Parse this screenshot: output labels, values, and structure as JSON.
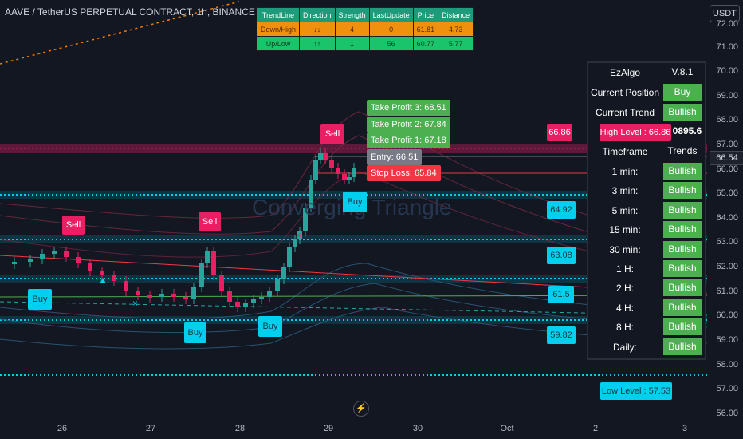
{
  "header": {
    "title": "AAVE / TetherUS PERPETUAL CONTRACT, 1h, BINANCE",
    "watermark": "Converging Triangle"
  },
  "currency_button": "USDT",
  "current_price": "66.54",
  "price_axis": [
    "72.00",
    "71.00",
    "70.00",
    "69.00",
    "68.00",
    "67.00",
    "66.00",
    "65.00",
    "64.00",
    "63.00",
    "62.00",
    "61.00",
    "60.00",
    "59.00",
    "58.00",
    "57.00",
    "56.00"
  ],
  "time_axis": [
    "26",
    "27",
    "28",
    "29",
    "30",
    "Oct",
    "2",
    "3"
  ],
  "trendline_table": {
    "headers": [
      "TrendLine",
      "Direction",
      "Strength",
      "LastUpdate",
      "Price",
      "Distance"
    ],
    "rows": [
      {
        "name": "Down/High",
        "direction": "↓↓",
        "strength": "4",
        "last_update": "0",
        "price": "61.81",
        "distance": "4.73"
      },
      {
        "name": "Up/Low",
        "direction": "↑↑",
        "strength": "1",
        "last_update": "56",
        "price": "60.77",
        "distance": "5.77"
      }
    ]
  },
  "trade_levels": {
    "tp3": "Take Profit 3: 68.51",
    "tp2": "Take Profit 2: 67.84",
    "tp1": "Take Profit 1: 67.18",
    "entry": "Entry: 66.51",
    "stop_loss": "Stop Loss: 65.84"
  },
  "signals": {
    "sell_1": "Sell",
    "sell_2": "Sell",
    "sell_3": "Sell",
    "buy_1": "Buy",
    "buy_2": "Buy",
    "buy_3": "Buy",
    "buy_4": "Buy"
  },
  "level_tags": {
    "l1": "66.86",
    "l2": "64.92",
    "l3": "63.08",
    "l4": "61.5",
    "l5": "59.82",
    "high_level": "High Level : 66.86",
    "low_level": "Low  Level : 57.53"
  },
  "ezalgo": {
    "title": "EzAlgo",
    "version": "V.8.1",
    "current_position_label": "Current Position",
    "current_position_value": "Buy",
    "current_trend_label": "Current Trend",
    "current_trend_value": "Bullish",
    "hidden_value": "0895.6",
    "timeframe_header": "Timeframe",
    "trends_header": "Trends",
    "rows": [
      {
        "tf": "1 min:",
        "trend": "Bullish"
      },
      {
        "tf": "3 min:",
        "trend": "Bullish"
      },
      {
        "tf": "5 min:",
        "trend": "Bullish"
      },
      {
        "tf": "15 min:",
        "trend": "Bullish"
      },
      {
        "tf": "30 min:",
        "trend": "Bullish"
      },
      {
        "tf": "1 H:",
        "trend": "Bullish"
      },
      {
        "tf": "2 H:",
        "trend": "Bullish"
      },
      {
        "tf": "4 H:",
        "trend": "Bullish"
      },
      {
        "tf": "8 H:",
        "trend": "Bullish"
      },
      {
        "tf": "Daily:",
        "trend": "Bullish"
      }
    ]
  },
  "colors": {
    "background": "#131722",
    "bull": "#26a69a",
    "bear": "#e91e63",
    "cyan": "#00d0ee",
    "green": "#4caf50",
    "red": "#f23645"
  }
}
